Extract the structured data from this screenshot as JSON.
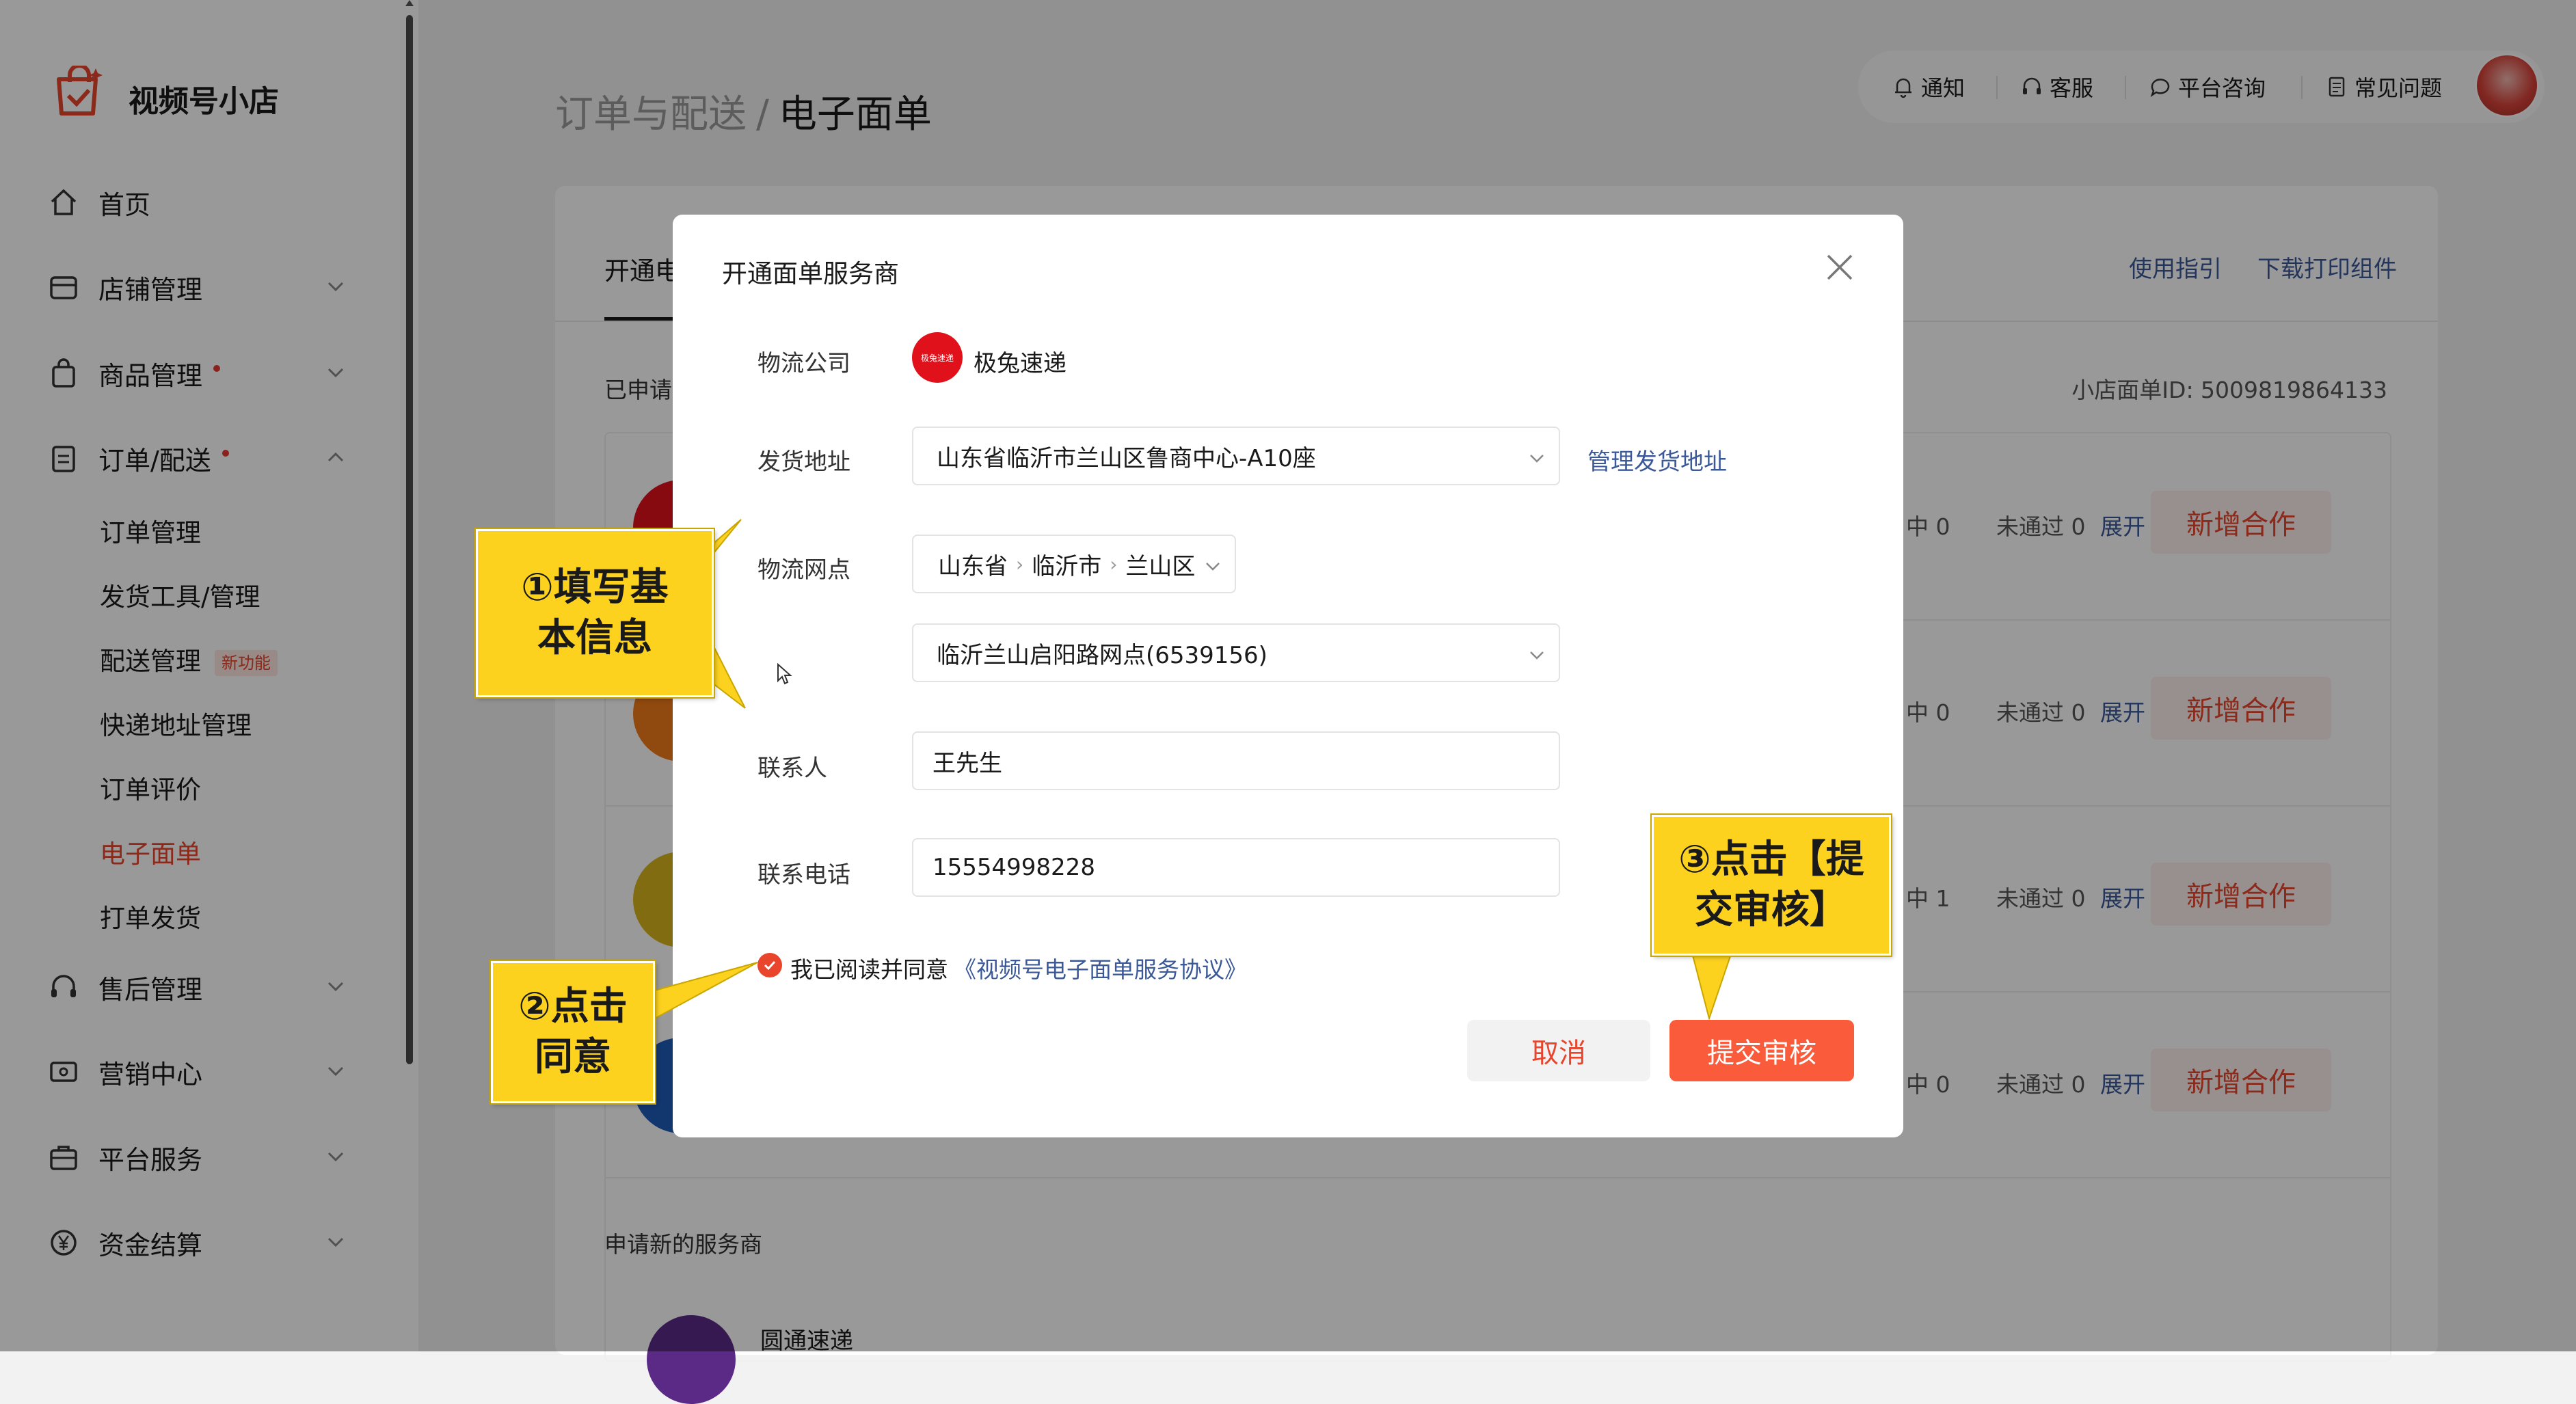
{
  "sidebar": {
    "logo_text": "视频号小店",
    "items": [
      {
        "label": "首页",
        "icon": "home-icon"
      },
      {
        "label": "店铺管理",
        "icon": "shop-icon"
      },
      {
        "label": "商品管理",
        "icon": "bag-icon"
      },
      {
        "label": "订单/配送",
        "icon": "clipboard-icon"
      },
      {
        "label": "售后管理",
        "icon": "headset-icon"
      },
      {
        "label": "营销中心",
        "icon": "ticket-icon"
      },
      {
        "label": "平台服务",
        "icon": "briefcase-icon"
      },
      {
        "label": "资金结算",
        "icon": "yen-icon"
      }
    ],
    "order_sub_items": [
      {
        "label": "订单管理"
      },
      {
        "label": "发货工具/管理"
      },
      {
        "label": "配送管理",
        "badge": "新功能"
      },
      {
        "label": "快递地址管理"
      },
      {
        "label": "订单评价"
      },
      {
        "label": "电子面单",
        "active": true
      },
      {
        "label": "打单发货"
      }
    ]
  },
  "header": {
    "breadcrumb_parent": "订单与配送",
    "breadcrumb_sep": "/",
    "breadcrumb_current": "电子面单",
    "topbar": {
      "notify": "通知",
      "service": "客服",
      "consult": "平台咨询",
      "faq": "常见问题"
    }
  },
  "page": {
    "tab_label": "开通电",
    "guide_link": "使用指引",
    "download_link": "下载打印组件",
    "applied_label": "已申请",
    "shop_waybill_id": "小店面单ID: 5009819864133",
    "providers": [
      {
        "stat_mid": "中 0",
        "stat_fail": "未通过 0",
        "expand": "展开",
        "add": "新增合作",
        "logo_color": "#e0111b"
      },
      {
        "stat_mid": "中 0",
        "stat_fail": "未通过 0",
        "expand": "展开",
        "add": "新增合作",
        "logo_color": "#f07a1a"
      },
      {
        "stat_mid": "中 1",
        "stat_fail": "未通过 0",
        "expand": "展开",
        "add": "新增合作",
        "logo_color": "#d9b51f"
      },
      {
        "stat_mid": "中 0",
        "stat_fail": "未通过 0",
        "expand": "展开",
        "add": "新增合作",
        "logo_color": "#1e5bb8"
      }
    ],
    "apply_new_label": "申请新的服务商",
    "new_provider_name": "圆通速递"
  },
  "modal": {
    "title": "开通面单服务商",
    "company_label": "物流公司",
    "company_logo_text": "极兔速递",
    "company_name": "极兔速递",
    "address_label": "发货地址",
    "address_value": "山东省临沂市兰山区鲁商中心-A10座",
    "manage_address_link": "管理发货地址",
    "outlet_label": "物流网点",
    "outlet_region": [
      "山东省",
      "临沂市",
      "兰山区"
    ],
    "outlet_value": "临沂兰山启阳路网点(6539156)",
    "contact_label": "联系人",
    "contact_value": "王先生",
    "phone_label": "联系电话",
    "phone_value": "15554998228",
    "agree_text": "我已阅读并同意",
    "agree_link": "《视频号电子面单服务协议》",
    "cancel_label": "取消",
    "submit_label": "提交审核"
  },
  "annotations": {
    "step1_line1": "①填写基",
    "step1_line2": "本信息",
    "step2_line1": "②点击",
    "step2_line2": "同意",
    "step3_line1": "③点击【提",
    "step3_line2": "交审核】"
  },
  "colors": {
    "accent": "#e8452c",
    "submit": "#fa5b3a",
    "link": "#3b5998",
    "callout": "#fcd21f"
  }
}
